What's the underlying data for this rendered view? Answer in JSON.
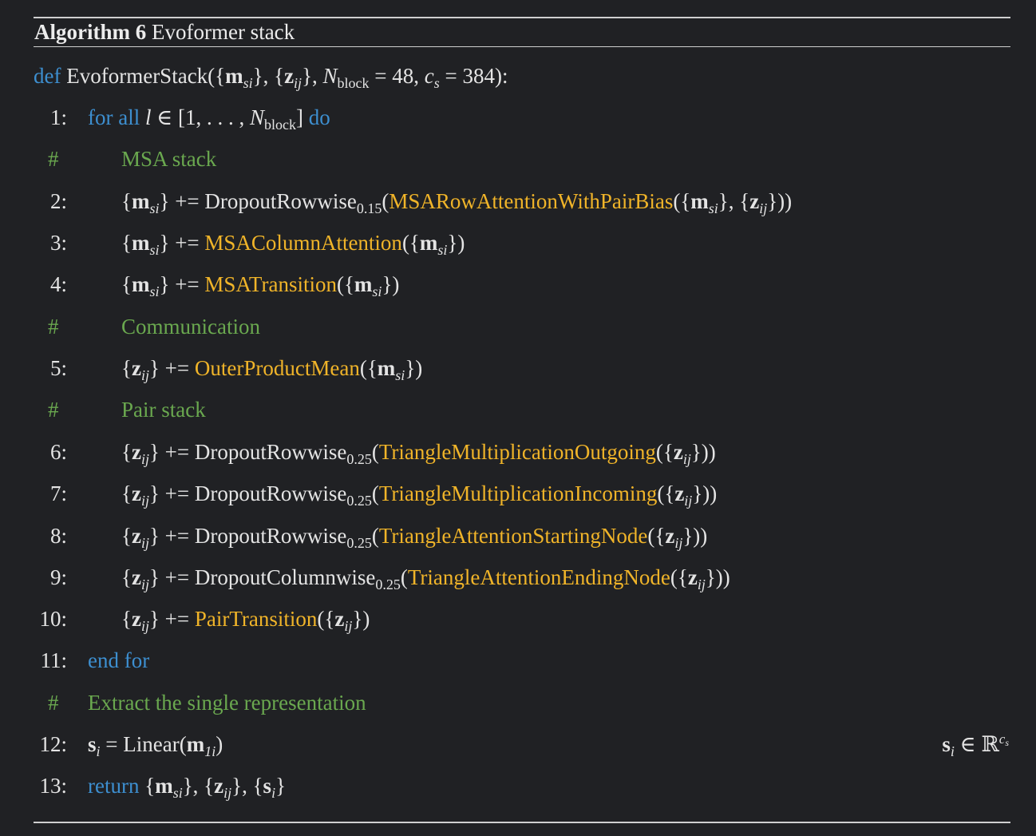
{
  "header": {
    "label": "Algorithm 6",
    "name": "Evoformer stack"
  },
  "def_line": {
    "keyword": "def",
    "fn_name": "EvoformerStack",
    "nblock_value": "48",
    "cs_value": "384"
  },
  "lines": {
    "l1": {
      "num": "1:",
      "kw_for": "for all",
      "kw_do": "do"
    },
    "c1": {
      "hash": "#",
      "text": "MSA stack"
    },
    "l2": {
      "num": "2:",
      "wrapper": "DropoutRowwise",
      "rate": "0.15",
      "fn": "MSARowAttentionWithPairBias"
    },
    "l3": {
      "num": "3:",
      "fn": "MSAColumnAttention"
    },
    "l4": {
      "num": "4:",
      "fn": "MSATransition"
    },
    "c2": {
      "hash": "#",
      "text": "Communication"
    },
    "l5": {
      "num": "5:",
      "fn": "OuterProductMean"
    },
    "c3": {
      "hash": "#",
      "text": "Pair stack"
    },
    "l6": {
      "num": "6:",
      "wrapper": "DropoutRowwise",
      "rate": "0.25",
      "fn": "TriangleMultiplicationOutgoing"
    },
    "l7": {
      "num": "7:",
      "wrapper": "DropoutRowwise",
      "rate": "0.25",
      "fn": "TriangleMultiplicationIncoming"
    },
    "l8": {
      "num": "8:",
      "wrapper": "DropoutRowwise",
      "rate": "0.25",
      "fn": "TriangleAttentionStartingNode"
    },
    "l9": {
      "num": "9:",
      "wrapper": "DropoutColumnwise",
      "rate": "0.25",
      "fn": "TriangleAttentionEndingNode"
    },
    "l10": {
      "num": "10:",
      "fn": "PairTransition"
    },
    "l11": {
      "num": "11:",
      "kw": "end for"
    },
    "c4": {
      "hash": "#",
      "text": "Extract the single representation"
    },
    "l12": {
      "num": "12:",
      "fn": "Linear"
    },
    "l13": {
      "num": "13:",
      "kw": "return"
    }
  },
  "colors": {
    "background": "#202124",
    "keyword": "#3d8fd0",
    "function": "#f0b429",
    "comment": "#6aa84f",
    "text": "#e4e4e4"
  }
}
